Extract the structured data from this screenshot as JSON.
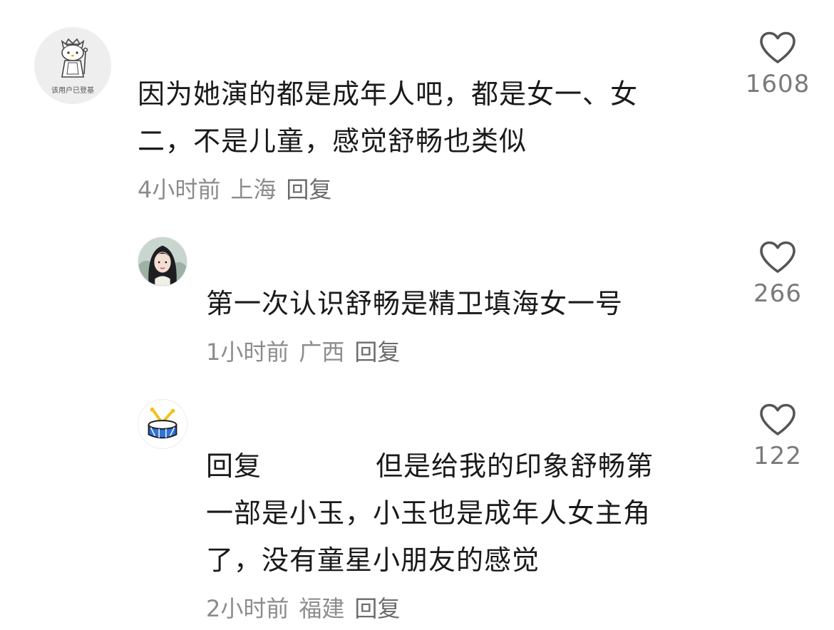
{
  "comments": [
    {
      "avatar_caption": "该用户已登基",
      "lines": [
        "因为她演的都是成年人吧，都是女一、女",
        "二，不是儿童，感觉舒畅也类似"
      ],
      "time": "4小时前",
      "location": "上海",
      "reply_label": "回复",
      "likes": "1608",
      "avatar_icon": "kitty-king-icon"
    },
    {
      "lines": [
        "第一次认识舒畅是精卫填海女一号"
      ],
      "time": "1小时前",
      "location": "广西",
      "reply_label": "回复",
      "likes": "266",
      "avatar_icon": "girl-portrait-icon"
    },
    {
      "reply_prefix": "回复",
      "lines_first": "但是给我的印象舒畅第",
      "lines": [
        "一部是小玉，小玉也是成年人女主角",
        "了，没有童星小朋友的感觉"
      ],
      "time": "2小时前",
      "location": "福建",
      "reply_label": "回复",
      "likes": "122",
      "avatar_icon": "drum-icon"
    }
  ],
  "colors": {
    "text": "#1a1a1a",
    "meta": "#8c8c8c",
    "like_icon": "#555555",
    "drum_blue": "#2f74d6",
    "drum_stick": "#f2c21b"
  }
}
